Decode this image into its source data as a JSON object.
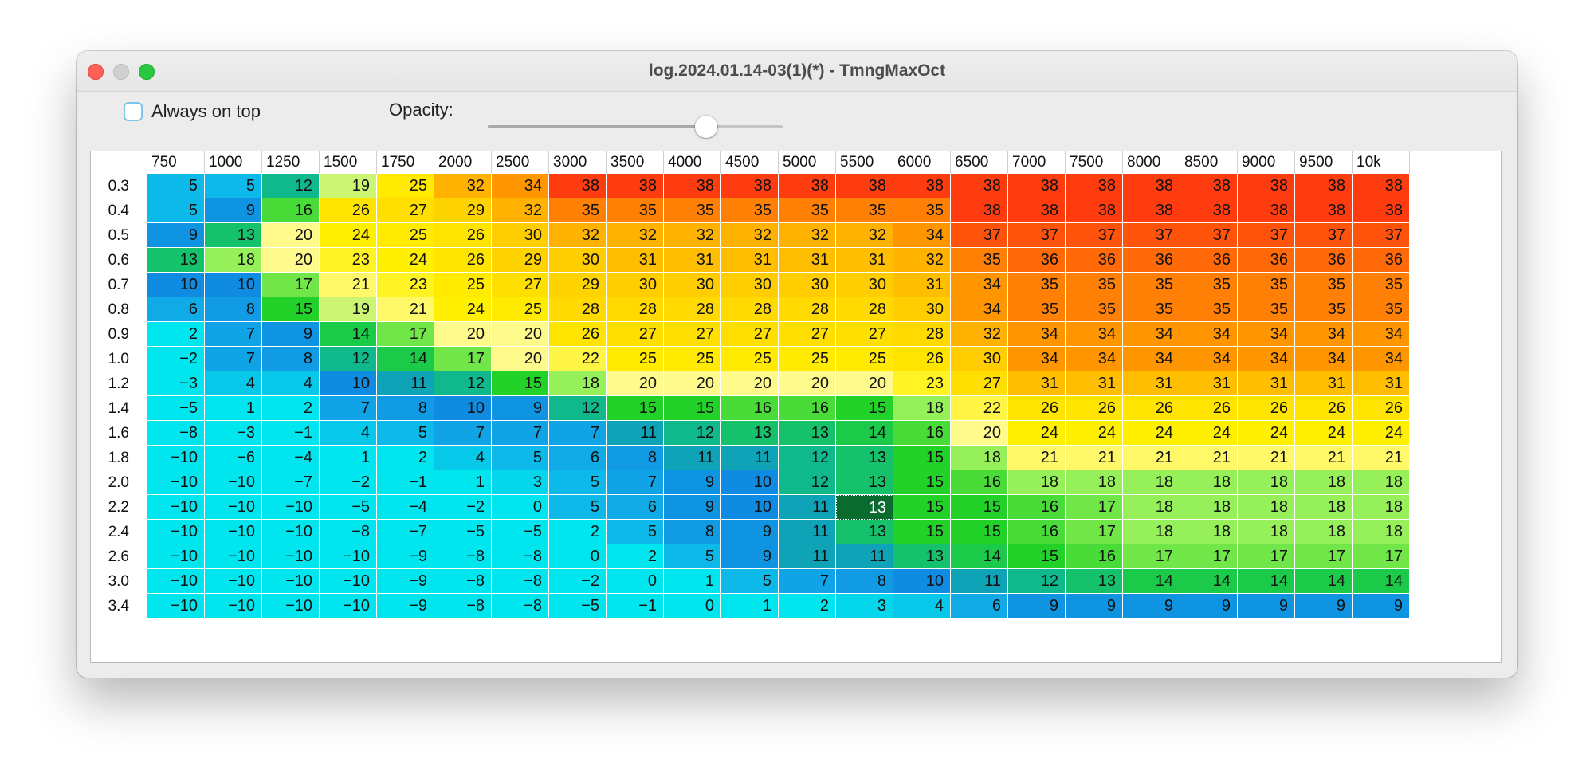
{
  "window": {
    "title": "log.2024.01.14-03(1)(*) - TmngMaxOct"
  },
  "controls": {
    "always_on_top_label": "Always on top",
    "always_on_top_checked": false,
    "opacity_label": "Opacity:",
    "opacity_value": 0.74
  },
  "colors": {
    "cyan": "#00e5ee",
    "blue": "#0f9be8",
    "green": "#33dd33",
    "yellow": "#fff200",
    "red": "#ff3d10"
  },
  "table": {
    "columns": [
      "750",
      "1000",
      "1250",
      "1500",
      "1750",
      "2000",
      "2500",
      "3000",
      "3500",
      "4000",
      "4500",
      "5000",
      "5500",
      "6000",
      "6500",
      "7000",
      "7500",
      "8000",
      "8500",
      "9000",
      "9500",
      "10k"
    ],
    "rows": [
      "0.3",
      "0.4",
      "0.5",
      "0.6",
      "0.7",
      "0.8",
      "0.9",
      "1.0",
      "1.2",
      "1.4",
      "1.6",
      "1.8",
      "2.0",
      "2.2",
      "2.4",
      "2.6",
      "3.0",
      "3.4"
    ],
    "values": [
      [
        "5",
        "5",
        "12",
        "19",
        "25",
        "32",
        "34",
        "38",
        "38",
        "38",
        "38",
        "38",
        "38",
        "38",
        "38",
        "38",
        "38",
        "38",
        "38",
        "38",
        "38",
        "38"
      ],
      [
        "5",
        "9",
        "16",
        "26",
        "27",
        "29",
        "32",
        "35",
        "35",
        "35",
        "35",
        "35",
        "35",
        "35",
        "38",
        "38",
        "38",
        "38",
        "38",
        "38",
        "38",
        "38"
      ],
      [
        "9",
        "13",
        "20",
        "24",
        "25",
        "26",
        "30",
        "32",
        "32",
        "32",
        "32",
        "32",
        "32",
        "34",
        "37",
        "37",
        "37",
        "37",
        "37",
        "37",
        "37",
        "37"
      ],
      [
        "13",
        "18",
        "20",
        "23",
        "24",
        "26",
        "29",
        "30",
        "31",
        "31",
        "31",
        "31",
        "31",
        "32",
        "35",
        "36",
        "36",
        "36",
        "36",
        "36",
        "36",
        "36"
      ],
      [
        "10",
        "10",
        "17",
        "21",
        "23",
        "25",
        "27",
        "29",
        "30",
        "30",
        "30",
        "30",
        "30",
        "31",
        "34",
        "35",
        "35",
        "35",
        "35",
        "35",
        "35",
        "35"
      ],
      [
        "6",
        "8",
        "15",
        "19",
        "21",
        "24",
        "25",
        "28",
        "28",
        "28",
        "28",
        "28",
        "28",
        "30",
        "34",
        "35",
        "35",
        "35",
        "35",
        "35",
        "35",
        "35"
      ],
      [
        "2",
        "7",
        "9",
        "14",
        "17",
        "20",
        "20",
        "26",
        "27",
        "27",
        "27",
        "27",
        "27",
        "28",
        "32",
        "34",
        "34",
        "34",
        "34",
        "34",
        "34",
        "34"
      ],
      [
        "−2",
        "7",
        "8",
        "12",
        "14",
        "17",
        "20",
        "22",
        "25",
        "25",
        "25",
        "25",
        "25",
        "26",
        "30",
        "34",
        "34",
        "34",
        "34",
        "34",
        "34",
        "34"
      ],
      [
        "−3",
        "4",
        "4",
        "10",
        "11",
        "12",
        "15",
        "18",
        "20",
        "20",
        "20",
        "20",
        "20",
        "23",
        "27",
        "31",
        "31",
        "31",
        "31",
        "31",
        "31",
        "31"
      ],
      [
        "−5",
        "1",
        "2",
        "7",
        "8",
        "10",
        "9",
        "12",
        "15",
        "15",
        "16",
        "16",
        "15",
        "18",
        "22",
        "26",
        "26",
        "26",
        "26",
        "26",
        "26",
        "26"
      ],
      [
        "−8",
        "−3",
        "−1",
        "4",
        "5",
        "7",
        "7",
        "7",
        "11",
        "12",
        "13",
        "13",
        "14",
        "16",
        "20",
        "24",
        "24",
        "24",
        "24",
        "24",
        "24",
        "24"
      ],
      [
        "−10",
        "−6",
        "−4",
        "1",
        "2",
        "4",
        "5",
        "6",
        "8",
        "11",
        "11",
        "12",
        "13",
        "15",
        "18",
        "21",
        "21",
        "21",
        "21",
        "21",
        "21",
        "21"
      ],
      [
        "−10",
        "−10",
        "−7",
        "−2",
        "−1",
        "1",
        "3",
        "5",
        "7",
        "9",
        "10",
        "12",
        "13",
        "15",
        "16",
        "18",
        "18",
        "18",
        "18",
        "18",
        "18",
        "18"
      ],
      [
        "−10",
        "−10",
        "−10",
        "−5",
        "−4",
        "−2",
        "0",
        "5",
        "6",
        "9",
        "10",
        "11",
        "13",
        "15",
        "15",
        "16",
        "17",
        "18",
        "18",
        "18",
        "18",
        "18"
      ],
      [
        "−10",
        "−10",
        "−10",
        "−8",
        "−7",
        "−5",
        "−5",
        "2",
        "5",
        "8",
        "9",
        "11",
        "13",
        "15",
        "15",
        "16",
        "17",
        "18",
        "18",
        "18",
        "18",
        "18"
      ],
      [
        "−10",
        "−10",
        "−10",
        "−10",
        "−9",
        "−8",
        "−8",
        "0",
        "2",
        "5",
        "9",
        "11",
        "11",
        "13",
        "14",
        "15",
        "16",
        "17",
        "17",
        "17",
        "17",
        "17"
      ],
      [
        "−10",
        "−10",
        "−10",
        "−10",
        "−9",
        "−8",
        "−8",
        "−2",
        "0",
        "1",
        "5",
        "7",
        "8",
        "10",
        "11",
        "12",
        "13",
        "14",
        "14",
        "14",
        "14",
        "14"
      ],
      [
        "−10",
        "−10",
        "−10",
        "−10",
        "−9",
        "−8",
        "−8",
        "−5",
        "−1",
        "0",
        "1",
        "2",
        "3",
        "4",
        "6",
        "9",
        "9",
        "9",
        "9",
        "9",
        "9",
        "9"
      ]
    ],
    "selected_cell": "2.2 / 5500 = 13"
  }
}
